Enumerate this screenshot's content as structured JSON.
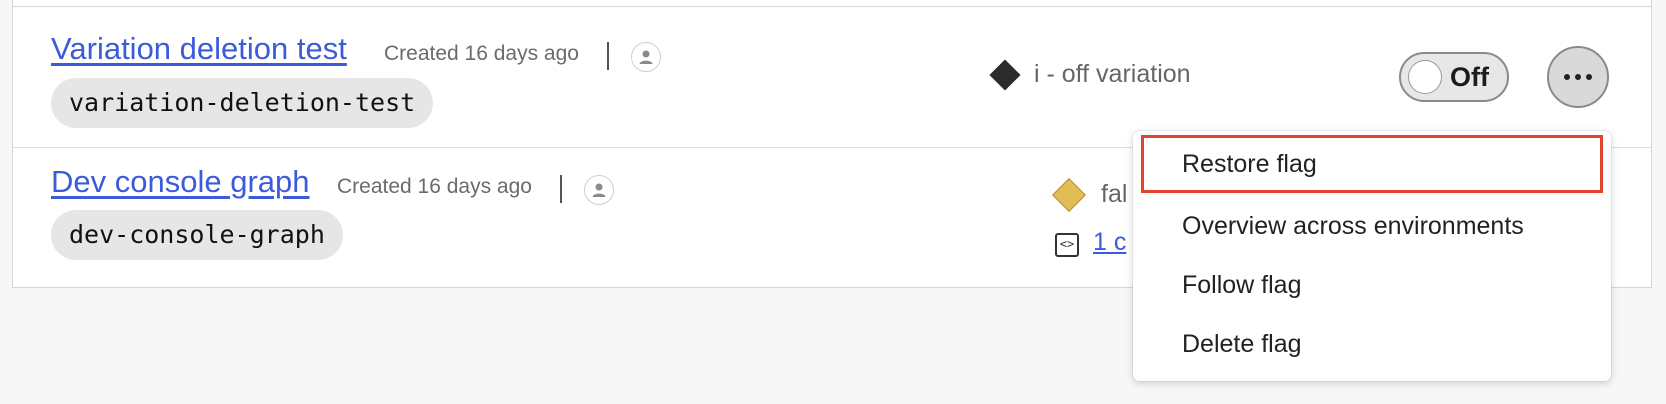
{
  "rows": [
    {
      "title": "Variation deletion test",
      "created": "Created 16 days ago",
      "key": "variation-deletion-test",
      "variation_label": "i - off variation",
      "variation_color": "#2b2b2b",
      "toggle_label": "Off"
    },
    {
      "title": "Dev console graph",
      "created": "Created 16 days ago",
      "key": "dev-console-graph",
      "variation_label": "fal",
      "variation_color": "#e2bc55",
      "code_refs_label": "1 c"
    }
  ],
  "menu": {
    "items": [
      {
        "label": "Restore flag",
        "highlighted": true
      },
      {
        "label": "Overview across environments"
      },
      {
        "label": "Follow flag"
      },
      {
        "label": "Delete flag"
      }
    ]
  },
  "icons": {
    "more": "more-horizontal-icon",
    "user": "user-avatar-icon",
    "code": "code-reference-icon",
    "variation": "diamond-icon"
  }
}
